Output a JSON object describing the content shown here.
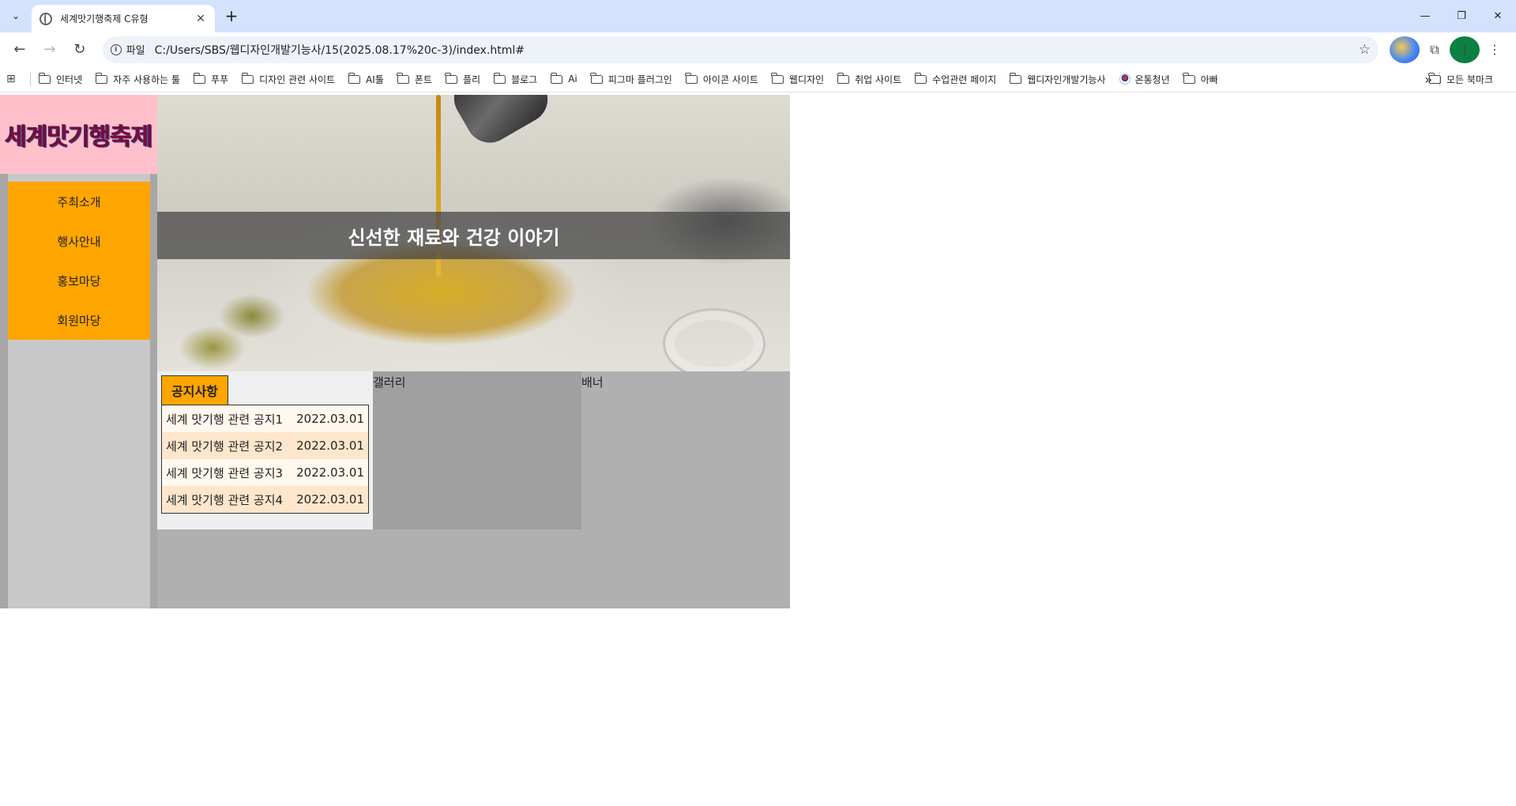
{
  "browser": {
    "tab_title": "세계맛기행축제 C유형",
    "url_scheme": "파일",
    "url": "C:/Users/SBS/웹디자인개발기능사/15(2025.08.17%20c-3)/index.html#",
    "avatar_letter": "j",
    "bookmarks": [
      "인터넷",
      "자주 사용하는 툴",
      "푸푸",
      "디자인 관련 사이트",
      "AI툴",
      "폰트",
      "플리",
      "블로그",
      "Ai",
      "피그마 플러그인",
      "아이콘 사이트",
      "웹디자인",
      "취업 사이트",
      "수업관련 페이지",
      "웹디자인개발기능사",
      "온통청년",
      "아빠"
    ],
    "all_bookmarks": "모든 북마크"
  },
  "site": {
    "logo": "세계맛기행축제",
    "menu": [
      "주최소개",
      "행사안내",
      "홍보마당",
      "회원마당"
    ],
    "hero_text": "신선한 재료와 건강 이야기",
    "notice_title": "공지사항",
    "notices": [
      {
        "title": "세계 맛기행 관련 공지1",
        "date": "2022.03.01"
      },
      {
        "title": "세계 맛기행 관련 공지2",
        "date": "2022.03.01"
      },
      {
        "title": "세계 맛기행 관련 공지3",
        "date": "2022.03.01"
      },
      {
        "title": "세계 맛기행 관련 공지4",
        "date": "2022.03.01"
      }
    ],
    "gallery_label": "갤러리",
    "banner_label": "배너"
  },
  "colors": {
    "logo_bg": "#ffc0cb",
    "menu_bg": "#ffa500",
    "tabbar_bg": "#d3e3fd"
  },
  "icons": {
    "tab_favicon": "globe-icon",
    "bookmark_folder": "folder-icon",
    "bookmark_flag": "korea-flag-icon"
  }
}
